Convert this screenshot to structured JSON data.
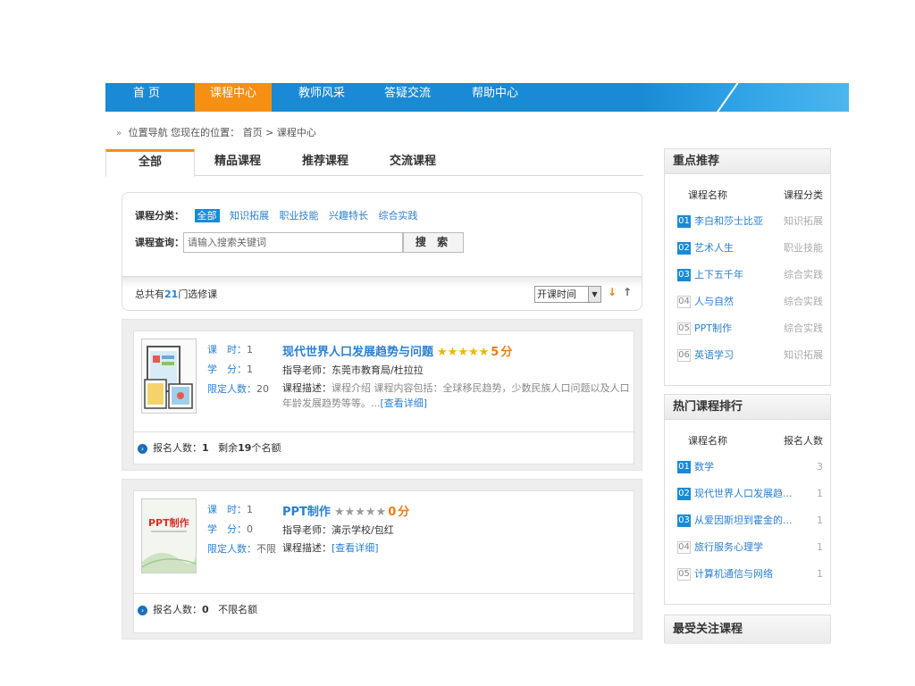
{
  "nav": {
    "items": [
      {
        "label": "首 页",
        "active": false
      },
      {
        "label": "课程中心",
        "active": true
      },
      {
        "label": "教师风采",
        "active": false
      },
      {
        "label": "答疑交流",
        "active": false
      },
      {
        "label": "帮助中心",
        "active": false
      }
    ]
  },
  "breadcrumb": {
    "label": "位置导航 您现在的位置：",
    "home": "首页",
    "sep": ">",
    "current": "课程中心"
  },
  "tabs": [
    {
      "label": "全部",
      "active": true
    },
    {
      "label": "精品课程",
      "active": false
    },
    {
      "label": "推荐课程",
      "active": false
    },
    {
      "label": "交流课程",
      "active": false
    }
  ],
  "filter": {
    "category_label": "课程分类：",
    "categories": [
      "全部",
      "知识拓展",
      "职业技能",
      "兴趣特长",
      "综合实践"
    ],
    "selected_index": 0,
    "query_label": "课程查询：",
    "search_placeholder": "请输入搜索关键词",
    "search_button": "搜 索"
  },
  "summary": {
    "prefix": "总共有",
    "count": "21",
    "suffix": "门选修课",
    "sort_value": "开课时间",
    "sort_down": "↓",
    "sort_up": "↑"
  },
  "courses": [
    {
      "hours_label": "课　时：",
      "hours": "1",
      "credit_label": "学　分：",
      "credit": "1",
      "limit_label": "限定人数：",
      "limit": "20",
      "title": "现代世界人口发展趋势与问题",
      "stars": "★★★★★",
      "rating": "5",
      "score_unit": "分",
      "teacher_label": "指导老师：",
      "teacher": "东莞市教育局/杜拉拉",
      "desc_label": "课程描述：",
      "desc": "课程介绍 课程内容包括：全球移民趋势，少数民族人口问题以及人口年龄发展趋势等等。...",
      "more": "[查看详细]",
      "enroll_label": "报名人数：",
      "enroll": "1",
      "remain_prefix": "剩余",
      "remain": "19",
      "remain_suffix": "个名额"
    },
    {
      "hours_label": "课　时：",
      "hours": "1",
      "credit_label": "学　分：",
      "credit": "0",
      "limit_label": "限定人数：",
      "limit": "不限",
      "title": "PPT制作",
      "stars": "★★★★★",
      "rating": "0",
      "score_unit": "分",
      "teacher_label": "指导老师：",
      "teacher": "演示学校/包红",
      "desc_label": "课程描述：",
      "desc": "",
      "more": "[查看详细]",
      "enroll_label": "报名人数：",
      "enroll": "0",
      "remain_text": "不限名额",
      "thumb_text": "PPT制作"
    }
  ],
  "sidebar": {
    "featured": {
      "title": "重点推荐",
      "col1": "课程名称",
      "col2": "课程分类",
      "rows": [
        {
          "rank": "01",
          "name": "李白和莎士比亚",
          "value": "知识拓展"
        },
        {
          "rank": "02",
          "name": "艺术人生",
          "value": "职业技能"
        },
        {
          "rank": "03",
          "name": "上下五千年",
          "value": "综合实践"
        },
        {
          "rank": "04",
          "name": "人与自然",
          "value": "综合实践"
        },
        {
          "rank": "05",
          "name": "PPT制作",
          "value": "综合实践"
        },
        {
          "rank": "06",
          "name": "英语学习",
          "value": "知识拓展"
        }
      ]
    },
    "hot": {
      "title": "热门课程排行",
      "col1": "课程名称",
      "col2": "报名人数",
      "rows": [
        {
          "rank": "01",
          "name": "数学",
          "value": "3"
        },
        {
          "rank": "02",
          "name": "现代世界人口发展趋...",
          "value": "1"
        },
        {
          "rank": "03",
          "name": "从爱因斯坦到霍金的...",
          "value": "1"
        },
        {
          "rank": "04",
          "name": "旅行服务心理学",
          "value": "1"
        },
        {
          "rank": "05",
          "name": "计算机通信与网络",
          "value": "1"
        }
      ]
    },
    "followed": {
      "title": "最受关注课程"
    }
  },
  "colors": {
    "nav_blue": "#1a8ad6",
    "nav_active": "#f78f12",
    "link_blue": "#2a7fd4",
    "star_gold": "#f0b400",
    "score_orange": "#f07b10"
  }
}
